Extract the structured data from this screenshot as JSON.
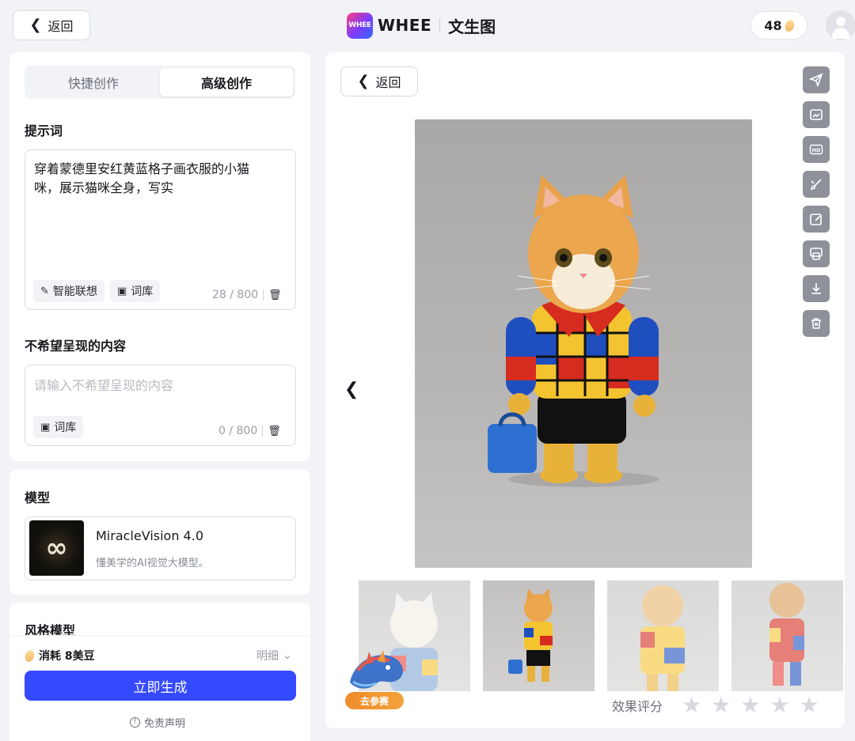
{
  "header": {
    "back_label": "返回",
    "logo_text": "WHEE",
    "brand": "WHEE",
    "page_title": "文生图",
    "beans": "48"
  },
  "left": {
    "tabs": [
      {
        "label": "快捷创作",
        "active": false
      },
      {
        "label": "高级创作",
        "active": true
      }
    ],
    "prompt": {
      "title": "提示词",
      "value": "穿着蒙德里安红黄蓝格子画衣服的小猫咪，展示猫咪全身，写实",
      "smart_label": "智能联想",
      "lexicon_label": "词库",
      "counter": "28 / 800"
    },
    "negative": {
      "title": "不希望呈现的内容",
      "placeholder": "请输入不希望呈现的内容",
      "lexicon_label": "词库",
      "counter": "0 / 800"
    },
    "model": {
      "title": "模型",
      "name": "MiracleVision 4.0",
      "desc": "懂美学的AI视觉大模型。"
    },
    "style": {
      "title": "风格模型"
    },
    "footer": {
      "cost": "消耗 8美豆",
      "detail": "明细",
      "generate": "立即生成",
      "disclaimer": "免责声明"
    }
  },
  "right": {
    "back_label": "返回",
    "tools": [
      "send-icon",
      "image-edit-icon",
      "hd-icon",
      "brush-icon",
      "edit-icon",
      "image-swap-icon",
      "download-icon",
      "trash-icon"
    ],
    "rating_label": "效果评分",
    "stars": 5,
    "dragon_label": "去参赛"
  }
}
